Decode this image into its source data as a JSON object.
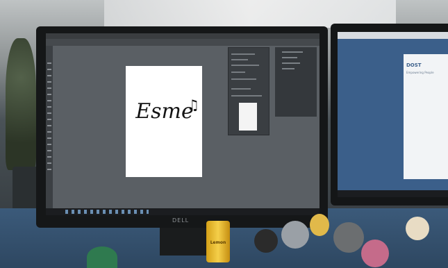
{
  "artwork": {
    "logo_text": "Esme",
    "note_glyph": "♫"
  },
  "monitor": {
    "brand": "DELL"
  },
  "second_screen": {
    "heading": "DOST",
    "subheading": "Empowering People"
  },
  "desk": {
    "can_label": "Lemon"
  },
  "icons": [
    "music-note-icon"
  ],
  "colors": {
    "workspace": "#5a5f64",
    "artboard": "#ffffff",
    "second_screen_bg": "#3b5f8a"
  }
}
